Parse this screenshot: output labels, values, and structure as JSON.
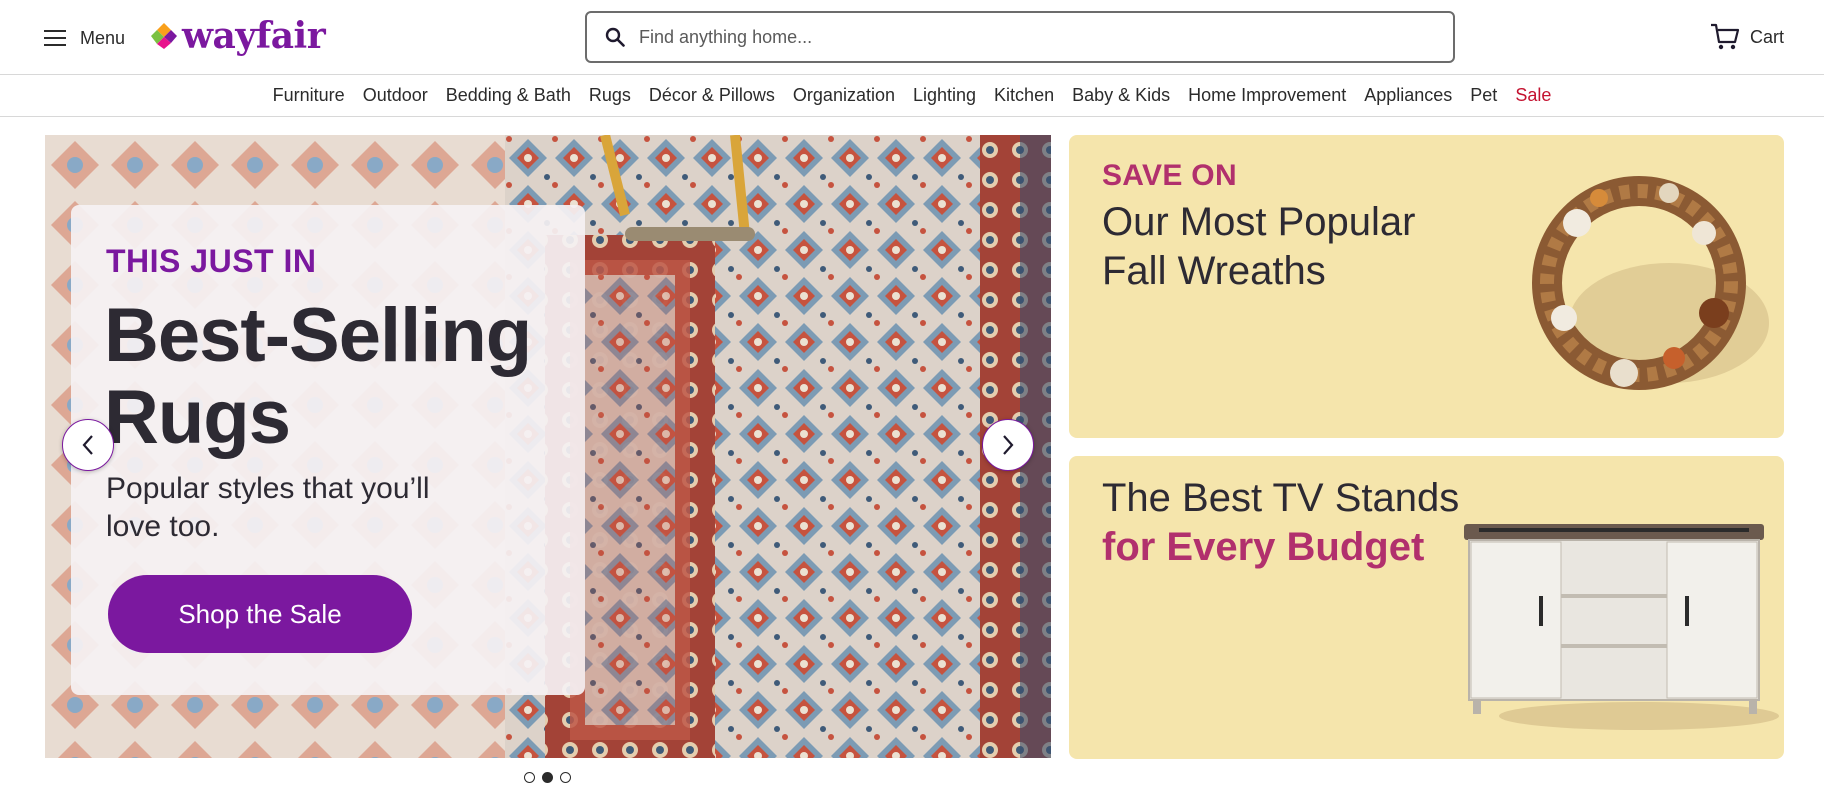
{
  "header": {
    "menu_label": "Menu",
    "logo_text": "wayfair",
    "search_placeholder": "Find anything home...",
    "cart_label": "Cart"
  },
  "nav": {
    "items": [
      "Furniture",
      "Outdoor",
      "Bedding & Bath",
      "Rugs",
      "Décor & Pillows",
      "Organization",
      "Lighting",
      "Kitchen",
      "Baby & Kids",
      "Home Improvement",
      "Appliances",
      "Pet"
    ],
    "sale_label": "Sale"
  },
  "hero": {
    "eyebrow": "THIS JUST IN",
    "title": "Best-Selling Rugs",
    "subtitle": "Popular styles that you’ll love too.",
    "cta_label": "Shop the Sale",
    "slide_count": 3,
    "active_slide": 2
  },
  "promos": {
    "wreaths": {
      "eyebrow": "SAVE ON",
      "title": "Our Most Popular Fall Wreaths"
    },
    "tv_stands": {
      "title": "The Best TV Stands",
      "accent": "for Every Budget"
    }
  },
  "colors": {
    "brand_purple": "#7b189f",
    "sale_red": "#c41230",
    "promo_bg": "#f5e5ac",
    "promo_accent": "#b1306d"
  },
  "icons": [
    "hamburger-icon",
    "wayfair-logo-mark",
    "search-icon",
    "cart-icon",
    "chevron-left-icon",
    "chevron-right-icon"
  ]
}
